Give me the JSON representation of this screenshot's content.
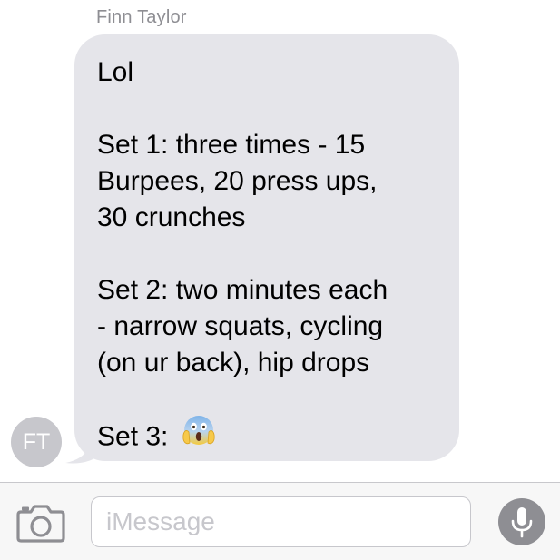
{
  "conversation": {
    "sender_name": "Finn Taylor",
    "avatar_initials": "FT"
  },
  "message": {
    "lines": [
      "Lol",
      "",
      "Set 1: three times - 15",
      "Burpees, 20 press ups,",
      "30 crunches",
      "",
      "Set 2: two minutes each",
      "- narrow squats, cycling",
      "(on ur back), hip drops",
      "",
      "Set 3:"
    ],
    "emoji": "face-screaming-in-fear"
  },
  "composer": {
    "placeholder": "iMessage",
    "camera_icon": "camera-icon",
    "mic_icon": "microphone-icon"
  },
  "colors": {
    "bubble": "#e5e5ea",
    "avatar": "#c7c7cc",
    "mic_button": "#8e8e93",
    "sender_name": "#8e8e93"
  }
}
